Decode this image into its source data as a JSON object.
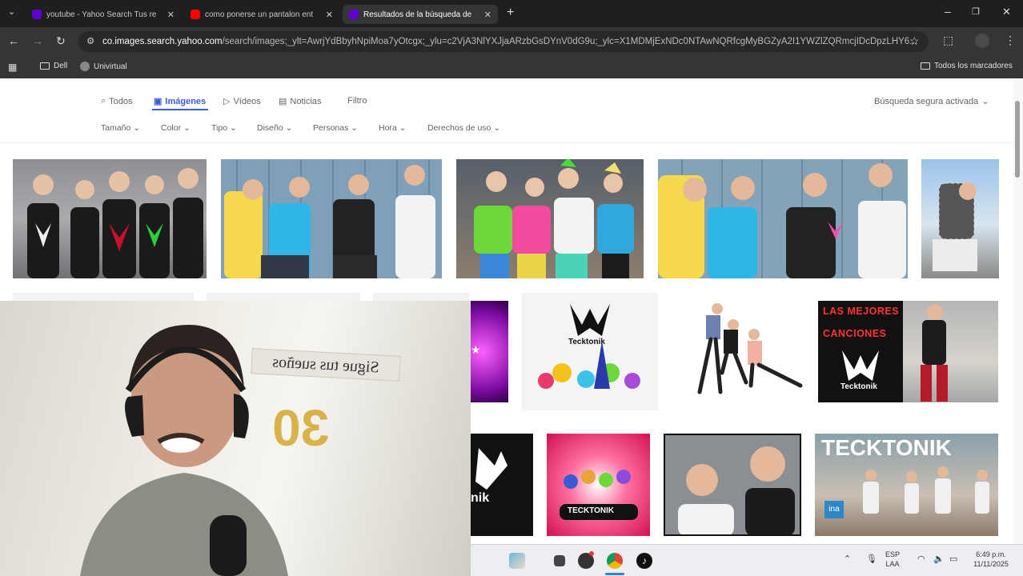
{
  "tabs": [
    {
      "label": "youtube - Yahoo Search Tus re",
      "favicon_color": "#6001d2"
    },
    {
      "label": "como ponerse un pantalon ent",
      "favicon_color": "#ff0000"
    },
    {
      "label": "Resultados de la búsqueda de",
      "favicon_color": "#6001d2"
    }
  ],
  "url": {
    "host": "co.images.search.yahoo.com",
    "path": "/search/images;_ylt=AwrjYdBbyhNpiMoa7yOtcgx;_ylu=c2VjA3NlYXJjaARzbGsDYnV0dG9u;_ylc=X1MDMjExNDc0NTAwNQRfcgMyBGZyA2I1YWZlZQRmcjIDcDpzLHY6..."
  },
  "bookmarks": {
    "items": [
      "Dell",
      "Univirtual"
    ],
    "all": "Todos los marcadores"
  },
  "search_nav": {
    "items": [
      "Todos",
      "Imágenes",
      "Vídeos",
      "Noticias",
      "Filtro"
    ],
    "active": "Imágenes",
    "safe_search": "Búsqueda segura activada"
  },
  "filters": [
    "Tamaño",
    "Color",
    "Tipo",
    "Diseño",
    "Personas",
    "Hora",
    "Derechos de uso"
  ],
  "thumbnails": {
    "tecktonik_logo_text": "Tecktonik",
    "mejores_line1": "LAS MEJORES",
    "mejores_line2": "CANCIONES",
    "tecktonik_banner": "TECKTONIK",
    "ina_badge": "ina",
    "nik_text": "nik",
    "tecktonik_sticker": "TECKTONIK"
  },
  "webcam": {
    "banner": "Sigue tus sueños",
    "balloon": "30"
  },
  "taskbar": {
    "lang1": "ESP",
    "lang2": "LAA",
    "time": "6:49 p.m.",
    "date": "11/11/2025"
  },
  "colors": {
    "accent": "#3d5fd4",
    "yahoo_purple": "#6001d2"
  }
}
